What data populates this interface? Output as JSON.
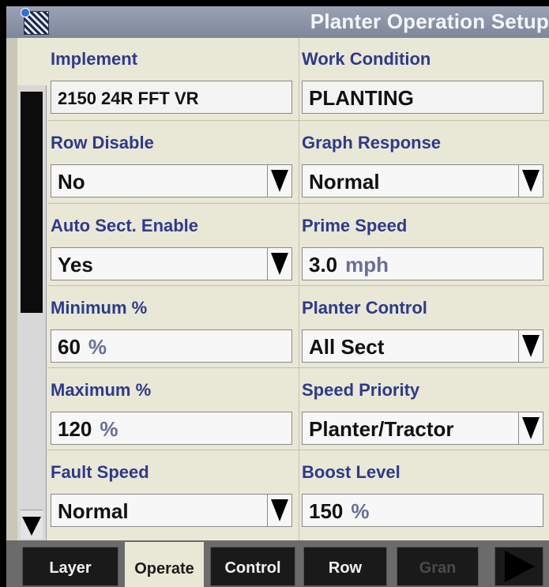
{
  "window": {
    "title": "Planter Operation Setup"
  },
  "fields": [
    {
      "label": "Implement",
      "value": "2150 24R FFT VR",
      "unit": "",
      "dropdown": false
    },
    {
      "label": "Work Condition",
      "value": "PLANTING",
      "unit": "",
      "dropdown": false
    },
    {
      "label": "Row Disable",
      "value": "No",
      "unit": "",
      "dropdown": true
    },
    {
      "label": "Graph Response",
      "value": "Normal",
      "unit": "",
      "dropdown": true
    },
    {
      "label": "Auto Sect. Enable",
      "value": "Yes",
      "unit": "",
      "dropdown": true
    },
    {
      "label": "Prime Speed",
      "value": "3.0",
      "unit": "mph",
      "dropdown": false
    },
    {
      "label": "Minimum %",
      "value": "60",
      "unit": "%",
      "dropdown": false
    },
    {
      "label": "Planter Control",
      "value": "All Sect",
      "unit": "",
      "dropdown": true
    },
    {
      "label": "Maximum %",
      "value": "120",
      "unit": "%",
      "dropdown": false
    },
    {
      "label": "Speed Priority",
      "value": "Planter/Tractor",
      "unit": "",
      "dropdown": true
    },
    {
      "label": "Fault Speed",
      "value": "Normal",
      "unit": "",
      "dropdown": true
    },
    {
      "label": "Boost Level",
      "value": "150",
      "unit": "%",
      "dropdown": false
    }
  ],
  "tabs": [
    {
      "label": "Layer",
      "state": "normal"
    },
    {
      "label": "Operate",
      "state": "active"
    },
    {
      "label": "Control",
      "state": "normal"
    },
    {
      "label": "Row",
      "state": "normal"
    },
    {
      "label": "Gran",
      "state": "disabled"
    }
  ],
  "icons": {
    "title_icon": "hatched-status-icon",
    "scroll_down": "triangle-down-icon",
    "dropdown": "triangle-down-icon",
    "next_tab": "triangle-right-icon"
  }
}
